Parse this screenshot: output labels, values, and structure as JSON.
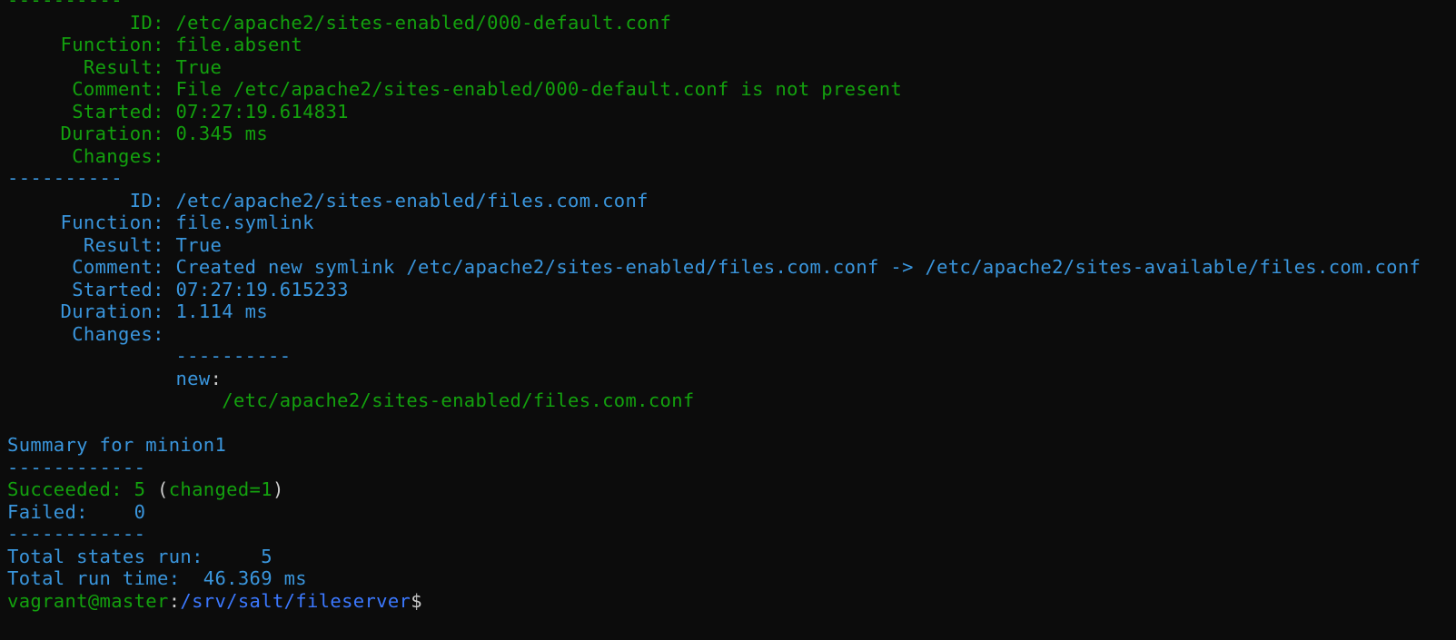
{
  "colors": {
    "background": "#0c0c0c",
    "green": "#13a10e",
    "blue": "#3a96dd",
    "prompt_path": "#3b78ff",
    "text": "#cccccc"
  },
  "separator": "----------",
  "separator_long": "------------",
  "state1": {
    "id_label": "ID:",
    "id": "/etc/apache2/sites-enabled/000-default.conf",
    "function_label": "Function:",
    "function": "file.absent",
    "result_label": "Result:",
    "result": "True",
    "comment_label": "Comment:",
    "comment": "File /etc/apache2/sites-enabled/000-default.conf is not present",
    "started_label": "Started:",
    "started": "07:27:19.614831",
    "duration_label": "Duration:",
    "duration": "0.345 ms",
    "changes_label": "Changes:"
  },
  "state2": {
    "id_label": "ID:",
    "id": "/etc/apache2/sites-enabled/files.com.conf",
    "function_label": "Function:",
    "function": "file.symlink",
    "result_label": "Result:",
    "result": "True",
    "comment_label": "Comment:",
    "comment": "Created new symlink /etc/apache2/sites-enabled/files.com.conf -> /etc/apache2/sites-available/files.com.conf",
    "started_label": "Started:",
    "started": "07:27:19.615233",
    "duration_label": "Duration:",
    "duration": "1.114 ms",
    "changes_label": "Changes:",
    "changes_separator": "----------",
    "changes_key": "new",
    "changes_colon": ":",
    "changes_value": "/etc/apache2/sites-enabled/files.com.conf"
  },
  "summary": {
    "title": "Summary for minion1",
    "succeeded_label": "Succeeded: 5 ",
    "succeeded_open": "(",
    "succeeded_changed": "changed=1",
    "succeeded_close": ")",
    "failed_label": "Failed:    0",
    "total_states": "Total states run:     5",
    "total_time": "Total run time:  46.369 ms"
  },
  "prompt": {
    "user_host": "vagrant@master",
    "colon": ":",
    "path": "/srv/salt/fileserver",
    "symbol": "$"
  }
}
